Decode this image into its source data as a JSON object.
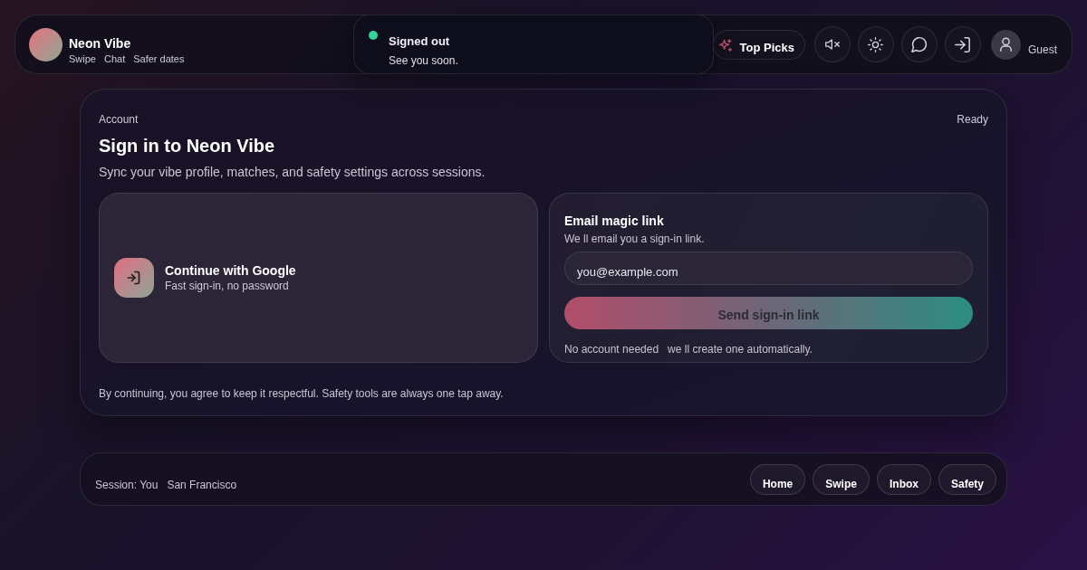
{
  "header": {
    "brand": {
      "name": "Neon Vibe",
      "tagline": [
        "Swipe",
        "Chat",
        "Safer dates"
      ]
    },
    "top_picks": {
      "label": "Top Picks"
    },
    "user": {
      "name": "Guest"
    }
  },
  "toast": {
    "title": "Signed out",
    "message": "See you soon."
  },
  "account": {
    "eyebrow": "Account",
    "status": "Ready",
    "title": "Sign in to Neon Vibe",
    "subtitle": "Sync your vibe profile, matches, and safety settings across sessions.",
    "google": {
      "title": "Continue with Google",
      "subtitle": "Fast sign-in, no password"
    },
    "email": {
      "title": "Email magic link",
      "subtitle": "We ll email you a sign-in link.",
      "field": {
        "value": "you@example.com"
      },
      "submit": {
        "label": "Send sign-in link"
      },
      "note": "No account needed   we ll create one automatically."
    },
    "footer": "By continuing, you agree to keep it respectful. Safety tools are always one tap away."
  },
  "session_bar": {
    "session": "Session: You",
    "location": "San Francisco",
    "nav": [
      {
        "label": "Home"
      },
      {
        "label": "Swipe"
      },
      {
        "label": "Inbox"
      },
      {
        "label": "Safety"
      }
    ]
  }
}
